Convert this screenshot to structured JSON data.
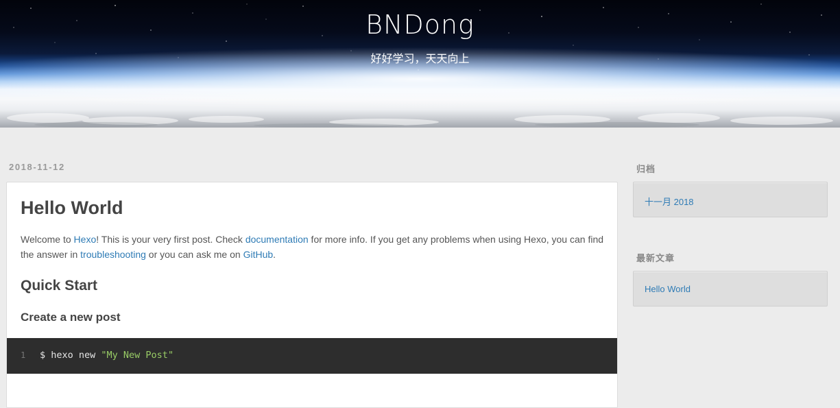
{
  "header": {
    "site_title": "BNDong",
    "subtitle": "好好学习，天天向上"
  },
  "post": {
    "date": "2018-11-12",
    "title": "Hello World",
    "intro": {
      "t1": "Welcome to ",
      "link_hexo": "Hexo",
      "t2": "! This is your very first post. Check ",
      "link_documentation": "documentation",
      "t3": " for more info. If you get any problems when using Hexo, you can find the answer in ",
      "link_troubleshooting": "troubleshooting",
      "t4": " or you can ask me on ",
      "link_github": "GitHub",
      "t5": "."
    },
    "heading_quick_start": "Quick Start",
    "heading_create_post": "Create a new post",
    "code": {
      "line_number": "1",
      "command": "$ hexo new ",
      "argument": "\"My New Post\""
    }
  },
  "sidebar": {
    "archives": {
      "title": "归档",
      "items": [
        {
          "label": "十一月 2018"
        }
      ]
    },
    "recent_posts": {
      "title": "最新文章",
      "items": [
        {
          "label": "Hello World"
        }
      ]
    }
  },
  "colors": {
    "link": "#2e7bb5",
    "code_background": "#2d2d2d",
    "code_string": "#99cc66",
    "page_background": "#ececec"
  }
}
